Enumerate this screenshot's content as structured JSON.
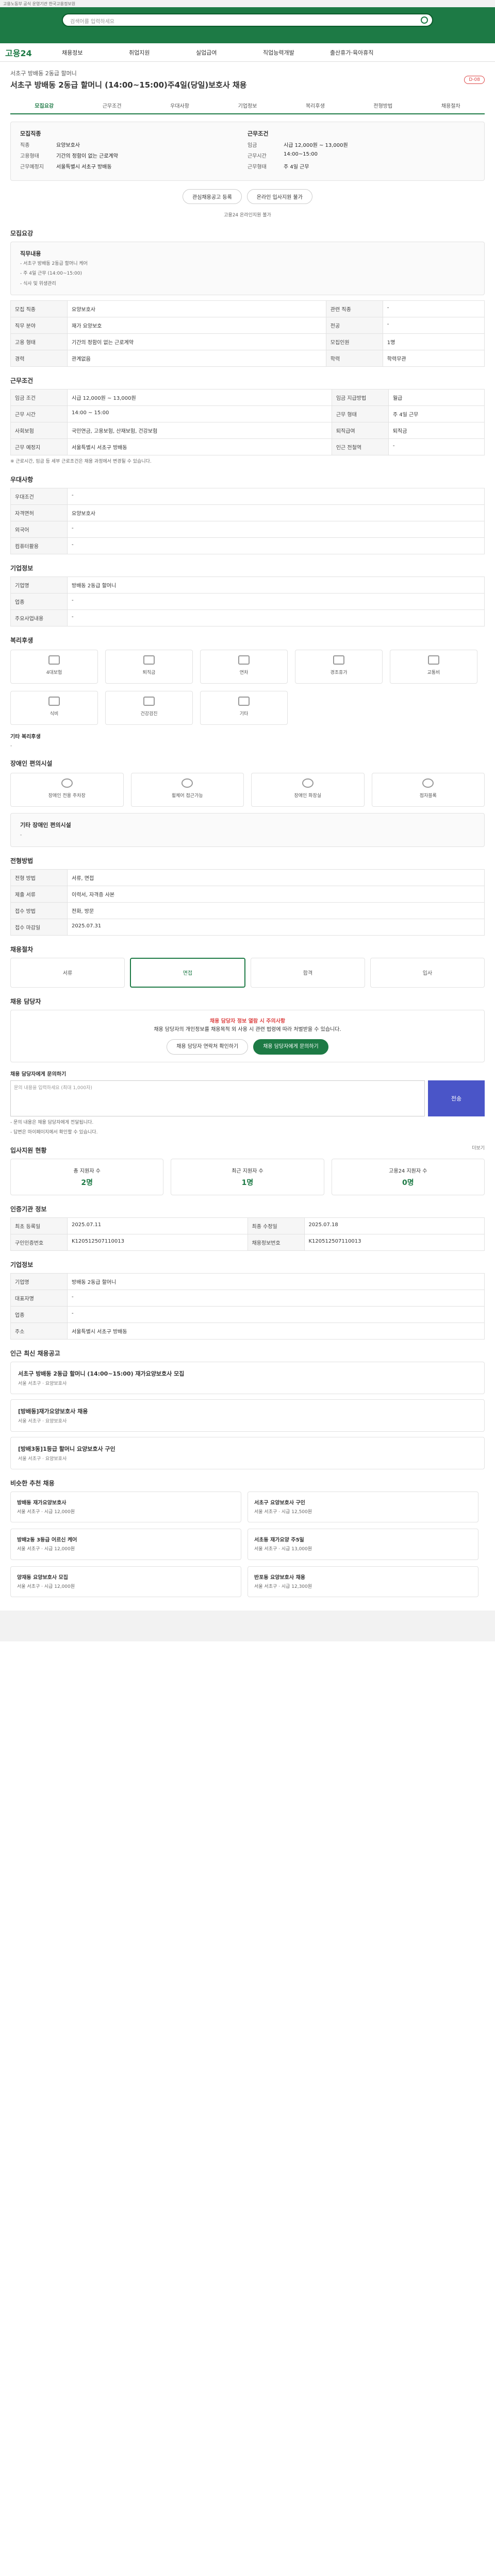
{
  "topbar": {
    "text": "고용노동부 공식 운영기관 한국고용정보원"
  },
  "search": {
    "placeholder": "검색어를 입력하세요"
  },
  "nav": {
    "logo": "고용24",
    "items": [
      "채용정보",
      "취업지원",
      "실업급여",
      "직업능력개발",
      "출산휴가·육아휴직"
    ]
  },
  "job": {
    "company": "서초구 방배동 2동급 할머니",
    "title": "서초구 방배동 2동급 할머니 (14:00~15:00)주4일(당일)보호사 채용",
    "badge": "D-08",
    "tabs": [
      "모집요강",
      "근무조건",
      "우대사항",
      "기업정보",
      "복리후생",
      "전형방법",
      "채용절차"
    ],
    "summary_left_heading": "모집직종",
    "summary_right_heading": "근무조건",
    "summary": [
      [
        "직종",
        "요양보호사"
      ],
      [
        "고용형태",
        "기간의 정함이 없는 근로계약"
      ],
      [
        "근무예정지",
        "서울특별시 서초구 방배동"
      ]
    ],
    "summary_right": [
      [
        "임금",
        "시급 12,000원 ~ 13,000원"
      ],
      [
        "근무시간",
        "14:00~15:00"
      ],
      [
        "근무형태",
        "주 4일 근무"
      ]
    ],
    "apply_btn": "온라인 입사지원 불가",
    "interest_btn": "관심채용공고 등록",
    "online_note": "고용24 온라인지원 불가"
  },
  "recruit": {
    "title": "모집요강",
    "box": [
      "직무내용",
      "- 서초구 방배동 2동급 할머니 케어",
      "- 주 4일 근무 (14:00~15:00)",
      "- 식사 및 위생관리"
    ],
    "rows": [
      [
        "모집 직종",
        "요양보호사",
        "관련 직종",
        "-"
      ],
      [
        "직무 분야",
        "재가 요양보호",
        "전공",
        "-"
      ],
      [
        "고용 형태",
        "기간의 정함이 없는 근로계약",
        "모집인원",
        "1명"
      ],
      [
        "경력",
        "관계없음",
        "학력",
        "학력무관"
      ]
    ]
  },
  "work": {
    "title": "근무조건",
    "rows": [
      [
        "임금 조건",
        "시급 12,000원 ~ 13,000원",
        "임금 지급방법",
        "월급"
      ],
      [
        "근무 시간",
        "14:00 ~ 15:00",
        "근무 형태",
        "주 4일 근무"
      ],
      [
        "사회보험",
        "국민연금, 고용보험, 산재보험, 건강보험",
        "퇴직급여",
        "퇴직금"
      ],
      [
        "근무 예정지",
        "서울특별시 서초구 방배동",
        "인근 전철역",
        "-"
      ]
    ],
    "note": "※ 근로시간, 임금 등 세부 근로조건은 채용 과정에서 변경될 수 있습니다."
  },
  "pref": {
    "title": "우대사항",
    "rows": [
      [
        "우대조건",
        "-"
      ],
      [
        "자격면허",
        "요양보호사"
      ],
      [
        "외국어",
        "-"
      ],
      [
        "컴퓨터활용",
        "-"
      ]
    ]
  },
  "corp": {
    "title": "기업정보",
    "rows": [
      [
        "기업명",
        "방배동 2동급 할머니"
      ],
      [
        "업종",
        "-"
      ],
      [
        "주요사업내용",
        "-"
      ]
    ]
  },
  "welfare": {
    "title": "복리후생",
    "items": [
      "4대보험",
      "퇴직금",
      "연차",
      "경조휴가",
      "교통비",
      "식비",
      "건강검진",
      "기타"
    ],
    "other_title": "기타 복리후생",
    "other": "-"
  },
  "disability": {
    "title": "장애인 편의시설",
    "items": [
      "장애인 전용 주차장",
      "휠체어 접근가능",
      "장애인 화장실",
      "점자블록"
    ],
    "other": "기타 장애인 편의시설",
    "other_val": "-"
  },
  "screening": {
    "title": "전형방법",
    "rows": [
      [
        "전형 방법",
        "서류, 면접"
      ],
      [
        "제출 서류",
        "이력서, 자격증 사본"
      ],
      [
        "접수 방법",
        "전화, 방문"
      ],
      [
        "접수 마감일",
        "2025.07.31"
      ]
    ]
  },
  "process": {
    "title": "채용절차",
    "tiles": [
      "서류",
      "면접",
      "합격",
      "입사"
    ]
  },
  "contact": {
    "title": "채용 담당자",
    "alert_red": "채용 담당자 정보 열람 시 주의사항",
    "alert_text": "채용 담당자의 개인정보를 채용목적 외 사용 시 관련 법령에 따라 처벌받을 수 있습니다.",
    "btn1": "채용 담당자 연락처 확인하기",
    "btn2": "채용 담당자에게 문의하기",
    "inquiry_title": "채용 담당자에게 문의하기",
    "inquiry_placeholder": "문의 내용을 입력하세요 (최대 1,000자)",
    "send": "전송",
    "notes": [
      "- 문의 내용은 채용 담당자에게 전달됩니다.",
      "- 답변은 마이페이지에서 확인할 수 있습니다."
    ]
  },
  "stats": {
    "title": "입사지원 현황",
    "more": "더보기",
    "cards": [
      [
        "총 지원자 수",
        "2명"
      ],
      [
        "최근 지원자 수",
        "1명"
      ],
      [
        "고용24 지원자 수",
        "0명"
      ]
    ]
  },
  "info": {
    "title": "인증기관 정보",
    "rows": [
      [
        "최초 등록일",
        "2025.07.11",
        "최종 수정일",
        "2025.07.18"
      ],
      [
        "구인인증번호",
        "K120512507110013",
        "채용정보번호",
        "K120512507110013"
      ]
    ]
  },
  "corpinfo": {
    "title": "기업정보",
    "rows": [
      [
        "기업명",
        "방배동 2동급 할머니"
      ],
      [
        "대표자명",
        "-"
      ],
      [
        "업종",
        "-"
      ],
      [
        "주소",
        "서울특별시 서초구 방배동"
      ]
    ]
  },
  "other_jobs": {
    "title": "인근 최신 채용공고",
    "items": [
      [
        "서초구 방배동 2동급 할머니 (14:00~15:00) 재가요양보호사 모집",
        "서울 서초구 · 요양보호사"
      ],
      [
        "[방배동]재가요양보호사 채용",
        "서울 서초구 · 요양보호사"
      ],
      [
        "[방배3동]1등급 할머니 요양보호사 구인",
        "서울 서초구 · 요양보호사"
      ]
    ]
  },
  "recommend": {
    "title": "비슷한 추천 채용",
    "items": [
      [
        "방배동 재가요양보호사",
        "서울 서초구 · 시급 12,000원"
      ],
      [
        "서초구 요양보호사 구인",
        "서울 서초구 · 시급 12,500원"
      ],
      [
        "방배2동 3등급 어르신 케어",
        "서울 서초구 · 시급 12,000원"
      ],
      [
        "서초동 재가요양 주5일",
        "서울 서초구 · 시급 13,000원"
      ],
      [
        "양재동 요양보호사 모집",
        "서울 서초구 · 시급 12,000원"
      ],
      [
        "반포동 요양보호사 채용",
        "서울 서초구 · 시급 12,300원"
      ]
    ]
  }
}
